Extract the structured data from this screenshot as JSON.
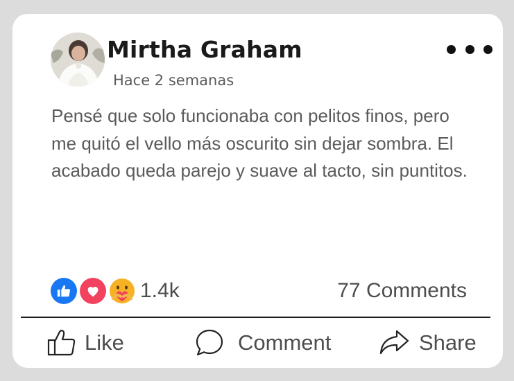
{
  "post": {
    "author": "Mirtha Graham",
    "time": "Hace 2 semanas",
    "text": "Pensé que solo funcionaba con pelitos finos, pero me quitó el vello más oscurito sin dejar sombra. El acabado queda parejo y suave al tacto, sin puntitos."
  },
  "stats": {
    "reaction_count": "1.4k",
    "reaction_icons": [
      "like-icon",
      "love-icon",
      "care-icon"
    ],
    "comments": "77 Comments"
  },
  "actions": {
    "like": "Like",
    "comment": "Comment",
    "share": "Share"
  },
  "colors": {
    "like_blue": "#1877f2",
    "love_red": "#f3425f",
    "care_yellow": "#f7b125"
  }
}
